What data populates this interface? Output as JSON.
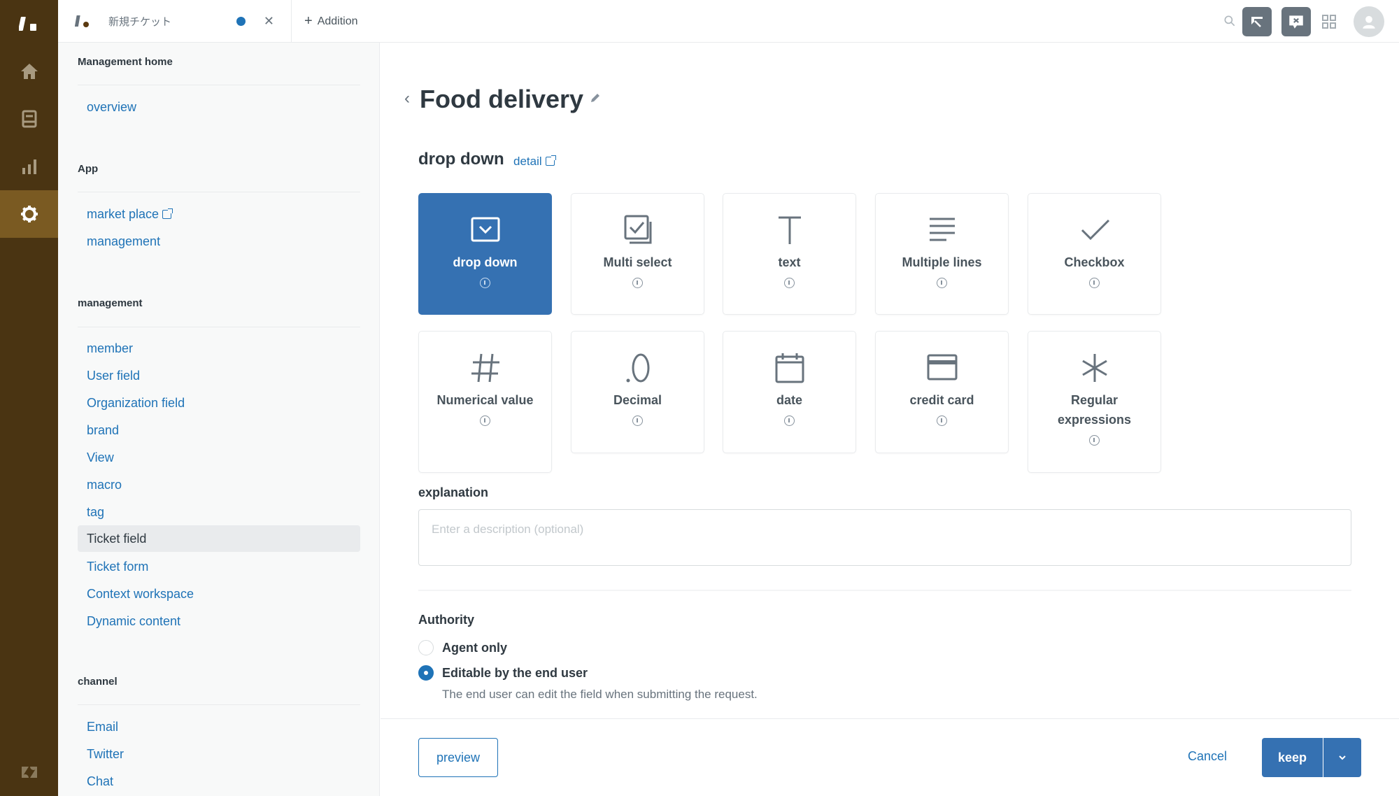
{
  "rail": {
    "items": [
      {
        "name": "home",
        "icon": "home-icon"
      },
      {
        "name": "tickets",
        "icon": "inbox-icon"
      },
      {
        "name": "reporting",
        "icon": "bar-chart-icon"
      },
      {
        "name": "admin",
        "icon": "gear-icon",
        "active": true
      }
    ],
    "bottom_logo": "zendesk-logo-icon"
  },
  "topbar": {
    "tab_title": "新規チケット",
    "add_label": "Addition",
    "icons": [
      "search-icon",
      "conversations-icon",
      "chat-icon",
      "apps-grid-icon",
      "user-avatar-icon"
    ]
  },
  "sidebar": {
    "sections": [
      {
        "heading": "Management home",
        "items": [
          {
            "label": "overview"
          }
        ]
      },
      {
        "heading": "App",
        "items": [
          {
            "label": "market place",
            "external": true
          },
          {
            "label": "management"
          }
        ]
      },
      {
        "heading": "management",
        "items": [
          {
            "label": "member"
          },
          {
            "label": "User field"
          },
          {
            "label": "Organization field"
          },
          {
            "label": "brand"
          },
          {
            "label": "View"
          },
          {
            "label": "macro"
          },
          {
            "label": "tag"
          },
          {
            "label": "Ticket field",
            "active": true
          },
          {
            "label": "Ticket form"
          },
          {
            "label": "Context workspace"
          },
          {
            "label": "Dynamic content"
          }
        ]
      },
      {
        "heading": "channel",
        "items": [
          {
            "label": "Email"
          },
          {
            "label": "Twitter"
          },
          {
            "label": "Chat"
          }
        ]
      }
    ]
  },
  "main": {
    "title": "Food delivery",
    "field_type_label": "drop down",
    "detail_link": "detail",
    "field_types": [
      {
        "label": "drop down",
        "icon": "dropdown-icon",
        "selected": true
      },
      {
        "label": "Multi select",
        "icon": "multi-select-icon"
      },
      {
        "label": "text",
        "icon": "text-icon"
      },
      {
        "label": "Multiple lines",
        "icon": "multiline-icon"
      },
      {
        "label": "Checkbox",
        "icon": "checkmark-icon"
      },
      {
        "label": "Numerical value",
        "icon": "hash-icon"
      },
      {
        "label": "Decimal",
        "icon": "decimal-icon"
      },
      {
        "label": "date",
        "icon": "calendar-icon"
      },
      {
        "label": "credit card",
        "icon": "credit-card-icon"
      },
      {
        "label": "Regular expressions",
        "icon": "asterisk-icon"
      }
    ],
    "explanation": {
      "label": "explanation",
      "placeholder": "Enter a description (optional)",
      "value": ""
    },
    "authority": {
      "label": "Authority",
      "options": [
        {
          "label": "Agent only",
          "checked": false
        },
        {
          "label": "Editable by the end user",
          "checked": true,
          "description": "The end user can edit the field when submitting the request."
        }
      ]
    }
  },
  "footer": {
    "preview_label": "preview",
    "cancel_label": "Cancel",
    "keep_label": "keep"
  },
  "colors": {
    "rail": "#4a3412",
    "rail_active": "#7a5a22",
    "accent": "#1f73b7",
    "selected_card": "#3571b2"
  }
}
